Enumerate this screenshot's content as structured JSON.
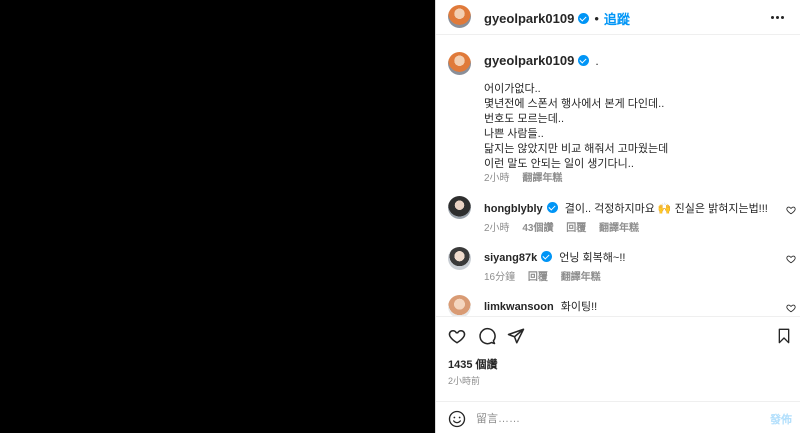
{
  "header": {
    "username": "gyeolpark0109",
    "dot": "•",
    "follow_label": "追蹤",
    "more_icon": "more-options-icon"
  },
  "caption": {
    "username": "gyeolpark0109",
    "suffix": ".",
    "lines": [
      "어이가없다..",
      "몇년전에 스폰서 행사에서 본게 다인데..",
      "번호도 모르는데..",
      "나쁜 사람들..",
      "닮지는 않았지만 비교 해줘서 고마웠는데",
      "이런 말도 안되는 일이 생기다니.."
    ],
    "time": "2小時",
    "translate": "翻譯年糕"
  },
  "comments": [
    {
      "username": "hongblybly",
      "text": "결이.. 걱정하지마요 🙌 진실은 밝혀지는법!!!",
      "time": "2小時",
      "likes": "43個讚",
      "reply": "回覆",
      "translate": "翻譯年糕"
    },
    {
      "username": "siyang87k",
      "text": "언닝 회복해~!!",
      "time": "16分鐘",
      "reply": "回覆",
      "translate": "翻譯年糕"
    },
    {
      "username": "limkwansoon",
      "text": "화이팅!!"
    }
  ],
  "actions": {
    "likes_count": "1435 個讚",
    "posted_time": "2小時前"
  },
  "add_comment": {
    "placeholder": "留言……",
    "post_label": "發佈"
  },
  "colors": {
    "accent": "#0095f6",
    "media_background": "#000000",
    "secondary_text": "#8e8e8e"
  }
}
